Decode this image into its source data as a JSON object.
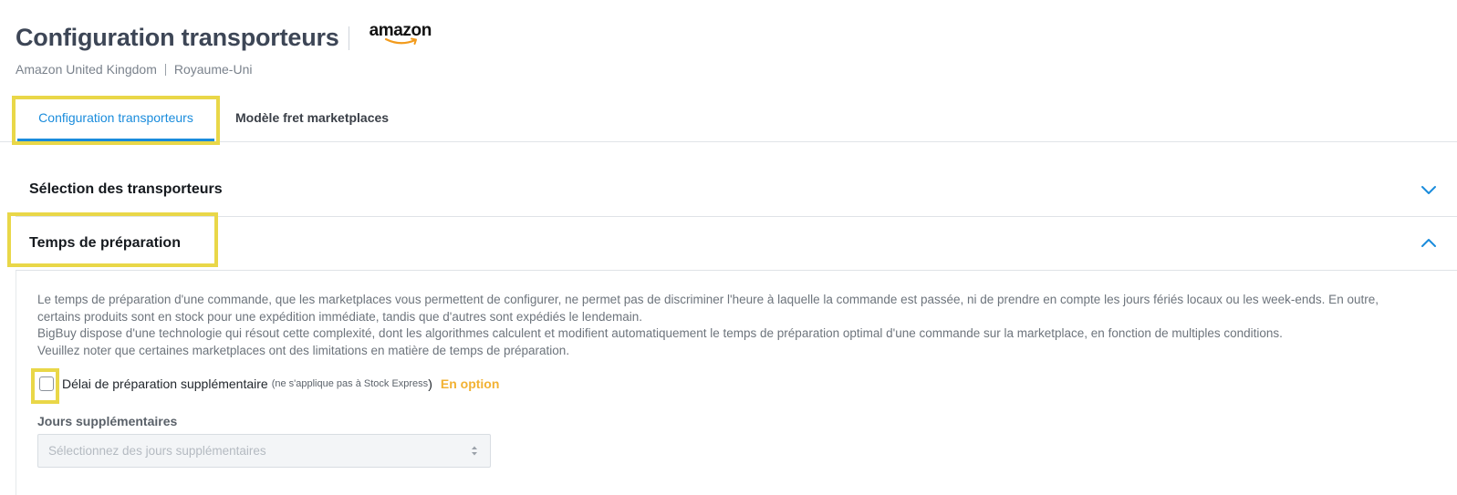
{
  "header": {
    "title": "Configuration transporteurs",
    "logo_text": "amazon",
    "subtitle_marketplace": "Amazon United Kingdom",
    "subtitle_country": "Royaume-Uni"
  },
  "tabs": [
    {
      "label": "Configuration transporteurs",
      "active": true
    },
    {
      "label": "Modèle fret marketplaces",
      "active": false
    }
  ],
  "accordion": [
    {
      "title": "Sélection des transporteurs",
      "expanded": false,
      "icon": "chevron-down-icon"
    },
    {
      "title": "Temps de préparation",
      "expanded": true,
      "icon": "chevron-up-icon"
    }
  ],
  "preparation": {
    "description": [
      "Le temps de préparation d'une commande, que les marketplaces vous permettent de configurer, ne permet pas de discriminer l'heure à laquelle la commande est passée, ni de prendre en compte les jours fériés locaux ou les week-ends. En outre, certains produits sont en stock pour une expédition immédiate, tandis que d'autres sont expédiés le lendemain.",
      "BigBuy dispose d'une technologie qui résout cette complexité, dont les algorithmes calculent et modifient automatiquement le temps de préparation optimal d'une commande sur la marketplace, en fonction de multiples conditions.",
      "Veuillez noter que certaines marketplaces ont des limitations en matière de temps de préparation."
    ],
    "checkbox_label": "Délai de préparation supplémentaire",
    "checkbox_note": "(ne s'applique pas à Stock Express",
    "checkbox_close": ")",
    "checkbox_checked": false,
    "option_badge": "En option",
    "field_label": "Jours supplémentaires",
    "select_placeholder": "Sélectionnez des jours supplémentaires"
  },
  "colors": {
    "accent": "#1a8cdc",
    "highlight": "#e9d748",
    "badge": "#f2b233"
  }
}
